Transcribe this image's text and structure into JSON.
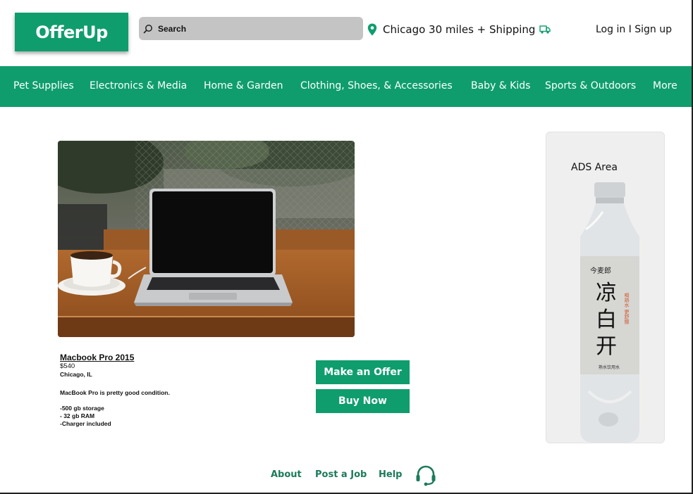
{
  "header": {
    "logo_text": "OfferUp",
    "search_placeholder": "Search",
    "location_text": "Chicago 30 miles + Shipping",
    "auth_text": "Log in I Sign up",
    "icons": {
      "search": "search-icon",
      "location": "map-pin-icon",
      "shipping": "truck-icon"
    }
  },
  "nav": {
    "items": [
      {
        "label": "Pet Supplies"
      },
      {
        "label": "Electronics & Media"
      },
      {
        "label": "Home & Garden"
      },
      {
        "label": "Clothing, Shoes, & Accessories"
      },
      {
        "label": "Baby & Kids"
      },
      {
        "label": "Sports & Outdoors"
      },
      {
        "label": "More"
      }
    ]
  },
  "product": {
    "title": "Macbook Pro 2015",
    "price": "$540",
    "location": "Chicago, IL",
    "description": "MacBook Pro is pretty good condition.",
    "specs": [
      "-500 gb storage",
      "- 32 gb RAM",
      "-Charger included"
    ],
    "make_offer_label": "Make an Offer",
    "buy_now_label": "Buy Now"
  },
  "ads": {
    "label": "ADS Area",
    "bottle_text": {
      "brand": "今麦郎",
      "big": [
        "凉",
        "白",
        "开"
      ],
      "side": "喝熟水 更舒服",
      "bottom": "熟水饮用水"
    }
  },
  "footer": {
    "about": "About",
    "post_job": "Post a Job",
    "help": "Help",
    "support_icon": "headset-icon"
  },
  "colors": {
    "brand": "#0f9d6e",
    "footer_link": "#1c7a5b",
    "search_bg": "#c4c4c4"
  }
}
